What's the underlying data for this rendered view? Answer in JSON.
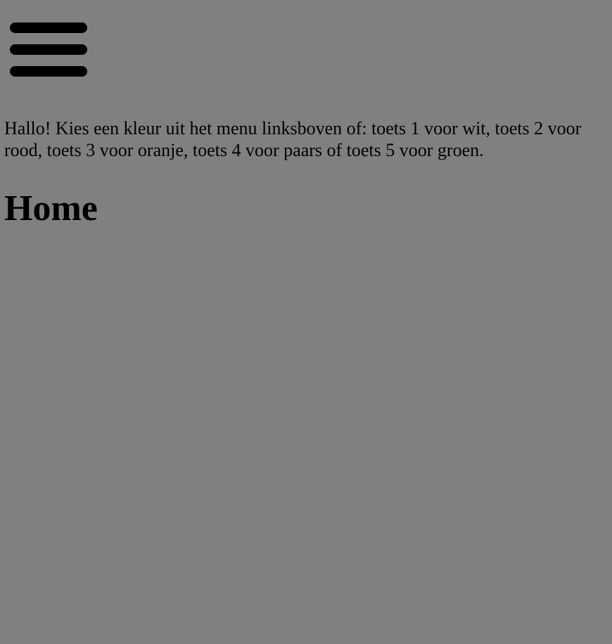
{
  "menu": {
    "icon": "hamburger-menu-icon",
    "bar_color": "#000000"
  },
  "intro_text": "Hallo! Kies een kleur uit het menu linksboven of: toets 1 voor wit, toets 2 voor rood, toets 3 voor oranje, toets 4 voor paars of toets 5 voor groen.",
  "page_title": "Home",
  "colors": {
    "background": "#808080",
    "text": "#000000"
  }
}
